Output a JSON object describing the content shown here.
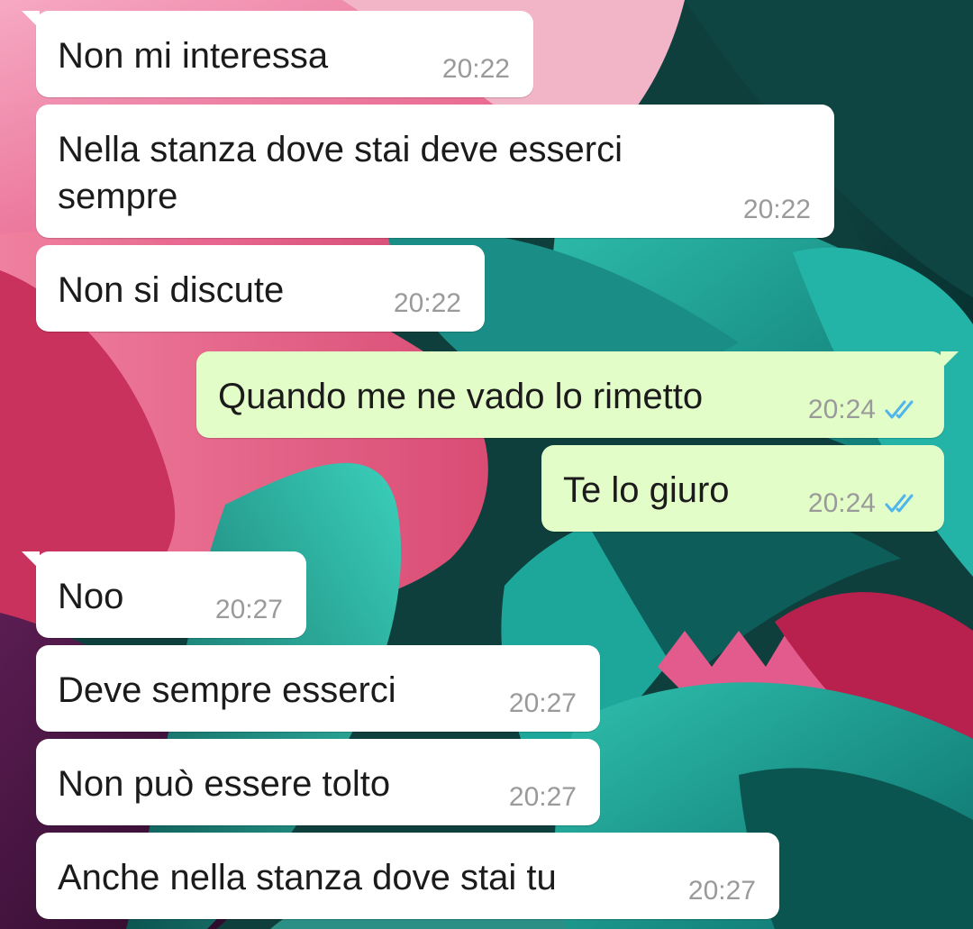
{
  "colors": {
    "incoming_bubble": "#ffffff",
    "outgoing_bubble": "#e3fdc9",
    "timestamp": "#9a9a9a",
    "read_ticks": "#4fb6ec"
  },
  "messages": [
    {
      "direction": "incoming",
      "text": "Non mi interessa",
      "time": "20:22"
    },
    {
      "direction": "incoming",
      "text": "Nella stanza dove stai deve esserci sempre",
      "time": "20:22"
    },
    {
      "direction": "incoming",
      "text": "Non si discute",
      "time": "20:22"
    },
    {
      "direction": "outgoing",
      "text": "Quando me ne vado lo rimetto",
      "time": "20:24",
      "status_icon": "double-check-read-icon"
    },
    {
      "direction": "outgoing",
      "text": "Te lo giuro",
      "time": "20:24",
      "status_icon": "double-check-read-icon"
    },
    {
      "direction": "incoming",
      "text": "Noo",
      "time": "20:27"
    },
    {
      "direction": "incoming",
      "text": "Deve sempre esserci",
      "time": "20:27"
    },
    {
      "direction": "incoming",
      "text": "Non può essere tolto",
      "time": "20:27"
    },
    {
      "direction": "incoming",
      "text": "Anche nella stanza dove stai tu",
      "time": "20:27"
    }
  ]
}
